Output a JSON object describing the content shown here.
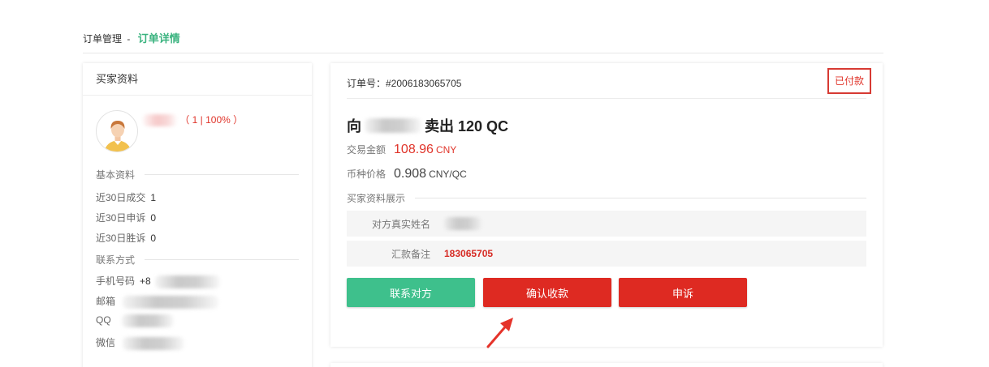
{
  "breadcrumb": {
    "parent": "订单管理",
    "separator": "-",
    "current": "订单详情"
  },
  "buyer": {
    "card_title": "买家资料",
    "stats_text": "（ 1 | 100% ）",
    "basic_section": "基本资料",
    "trades_label": "近30日成交",
    "trades_value": "1",
    "appeals_label": "近30日申诉",
    "appeals_value": "0",
    "wins_label": "近30日胜诉",
    "wins_value": "0",
    "contact_section": "联系方式",
    "phone_label": "手机号码",
    "phone_prefix": "+8",
    "email_label": "邮箱",
    "qq_label": "QQ",
    "wechat_label": "微信"
  },
  "order": {
    "number_label": "订单号：#2006183065705",
    "status": "已付款",
    "headline_prefix": "向",
    "headline_suffix": "卖出 120 QC",
    "amount_label": "交易金额",
    "amount_value": "108.96",
    "amount_unit": "CNY",
    "price_label": "币种价格",
    "price_value": "0.908",
    "price_unit": "CNY/QC",
    "buyer_info_section": "买家资料展示",
    "real_name_label": "对方真实姓名",
    "remark_label": "汇款备注",
    "remark_value": "183065705"
  },
  "actions": {
    "contact_label": "联系对方",
    "confirm_label": "确认收款",
    "appeal_label": "申诉"
  },
  "colors": {
    "accent_green": "#3ab37f",
    "button_green": "#3ec08c",
    "button_red": "#de2a22",
    "price_red": "#e0352b",
    "arrow_red": "#e5332a"
  }
}
